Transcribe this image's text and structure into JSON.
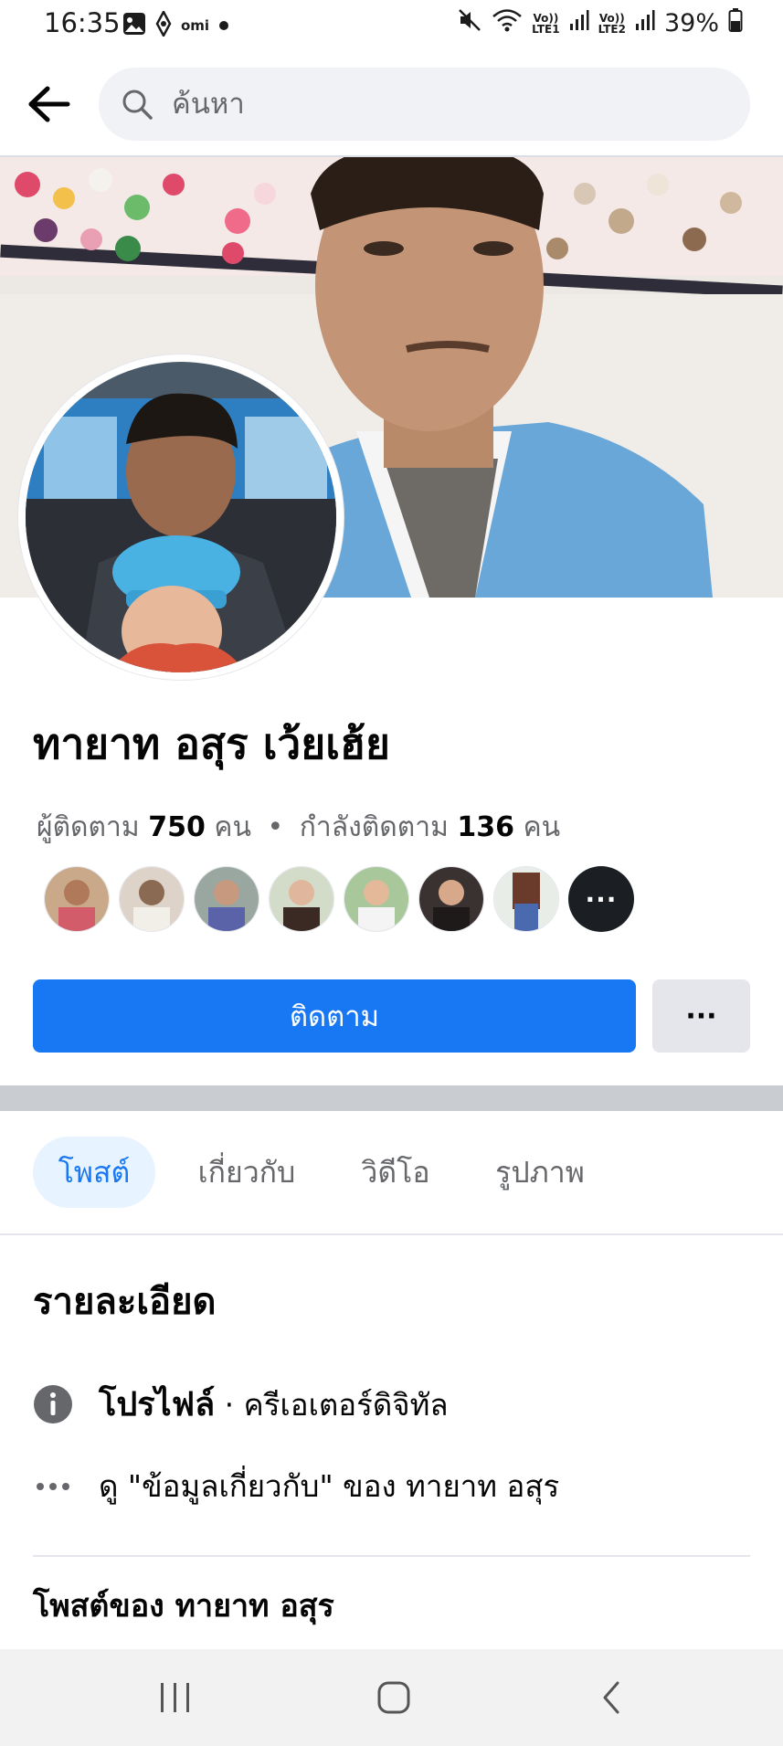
{
  "status_bar": {
    "time": "16:35",
    "carrier_label": "omi",
    "sim1_label_top": "Vo))",
    "sim1_label_bottom": "LTE1",
    "sim2_label_top": "Vo))",
    "sim2_label_bottom": "LTE2",
    "battery": "39%",
    "icons": [
      "image-icon",
      "vpn-key-icon",
      "dot-icon",
      "mute-icon",
      "wifi-icon",
      "signal-icon",
      "battery-icon"
    ]
  },
  "header": {
    "search_placeholder": "ค้นหา",
    "icons": [
      "back-arrow-icon",
      "search-icon"
    ]
  },
  "profile": {
    "name": "ทายาท อสุร เว้ยเฮ้ย",
    "followers_label": "ผู้ติดตาม",
    "followers_count": "750",
    "followers_unit": "คน",
    "stats_separator": "•",
    "following_label": "กำลังติดตาม",
    "following_count": "136",
    "following_unit": "คน",
    "friends_more_label": "···"
  },
  "actions": {
    "follow_label": "ติดตาม",
    "more_label": "···"
  },
  "tabs": [
    {
      "label": "โพสต์",
      "active": true
    },
    {
      "label": "เกี่ยวกับ",
      "active": false
    },
    {
      "label": "วิดีโอ",
      "active": false
    },
    {
      "label": "รูปภาพ",
      "active": false
    }
  ],
  "details": {
    "title": "รายละเอียด",
    "profile_label": "โปรไฟล์",
    "profile_separator": " · ",
    "profile_category": "ครีเอเตอร์ดิจิทัล",
    "about_link": "ดู \"ข้อมูลเกี่ยวกับ\" ของ ทายาท อสุร",
    "posts_title": "โพสต์ของ ทายาท อสุร"
  },
  "colors": {
    "accent": "#1877f2",
    "tab_active_bg": "#e7f3ff",
    "secondary_button": "#e4e6eb",
    "secondary_text": "#65676b",
    "section_gap": "#c9ccd1"
  }
}
